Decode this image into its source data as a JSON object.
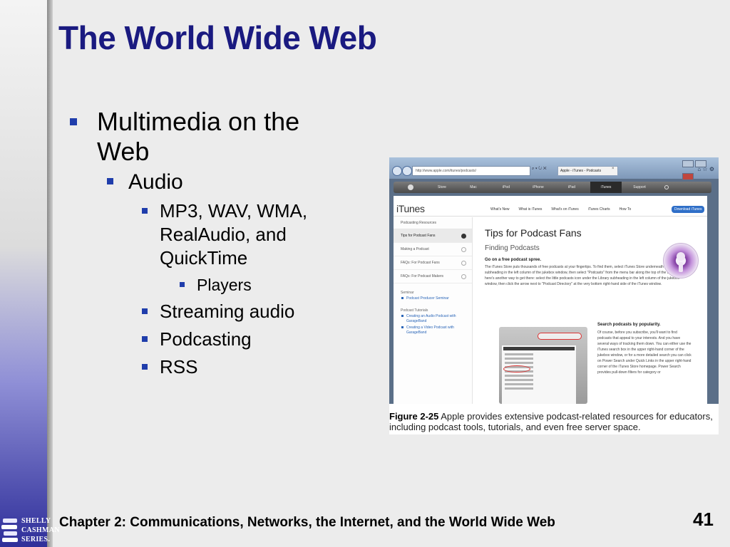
{
  "slide": {
    "title": "The World Wide Web",
    "footer": "Chapter 2: Communications, Networks, the Internet, and the World Wide Web",
    "page_number": "41",
    "logo_lines": [
      "SHELLY",
      "CASHMAN",
      "SERIES."
    ]
  },
  "bullets": {
    "l1": "Multimedia on the Web",
    "l2": "Audio",
    "l3a": "MP3, WAV, WMA, RealAudio, and QuickTime",
    "l4": "Players",
    "l3b": "Streaming audio",
    "l3c": "Podcasting",
    "l3d": "RSS"
  },
  "figure": {
    "caption_label": "Figure 2-25",
    "caption_text": "Apple provides extensive podcast-related resources for educators, including podcast tools, tutorials, and even free server space.",
    "browser": {
      "address": "http://www.apple.com/itunes/podcasts/",
      "tab_title": "Apple - iTunes - Podcasts"
    },
    "apple_nav": [
      "Store",
      "Mac",
      "iPod",
      "iPhone",
      "iPad",
      "iTunes",
      "Support"
    ],
    "itunes_logo": "iTunes",
    "subnav": [
      "What's New",
      "What is iTunes",
      "What's on iTunes",
      "iTunes Charts",
      "How To"
    ],
    "download_button": "Download iTunes",
    "sidebar": {
      "heading": "Podcasting Resources",
      "items": [
        "Tips for Podcast Fans",
        "Making a Podcast",
        "FAQs: For Podcast Fans",
        "FAQs: For Podcast Makers"
      ],
      "group1": "Seminar",
      "group1_links": [
        "Podcast Producer Seminar"
      ],
      "group2": "Podcast Tutorials",
      "group2_links": [
        "Creating an Audio Podcast with GarageBand",
        "Creating a Video Podcast with GarageBand"
      ]
    },
    "content": {
      "h1": "Tips for Podcast Fans",
      "h2": "Finding Podcasts",
      "h3": "Go on a free podcast spree.",
      "p1": "The iTunes Store puts thousands of free podcasts at your fingertips. To find them, select iTunes Store underneath the Store subheading in the left column of the jukebox window, then select \"Podcasts\" from the menu bar along the top of the store. Or, here's another way to get there: select the little podcasts icon under the Library subheading in the left column of the jukebox window, then click the arrow next to \"Podcast Directory\" at the very bottom right-hand side of the iTunes window.",
      "h4": "Search podcasts by popularity.",
      "p2": "Of course, before you subscribe, you'll want to find podcasts that appeal to your interests. And you have several ways of tracking them down. You can either use the iTunes search box in the upper right-hand corner of the jukebox window, or for a more detailed search you can click on Power Search under Quick Links in the upper right-hand corner of the iTunes Store homepage. Power Search provides pull-down filters for category or"
    }
  },
  "colors": {
    "title": "#1a1a80",
    "bullet": "#1f3dab",
    "background": "#ececec"
  }
}
